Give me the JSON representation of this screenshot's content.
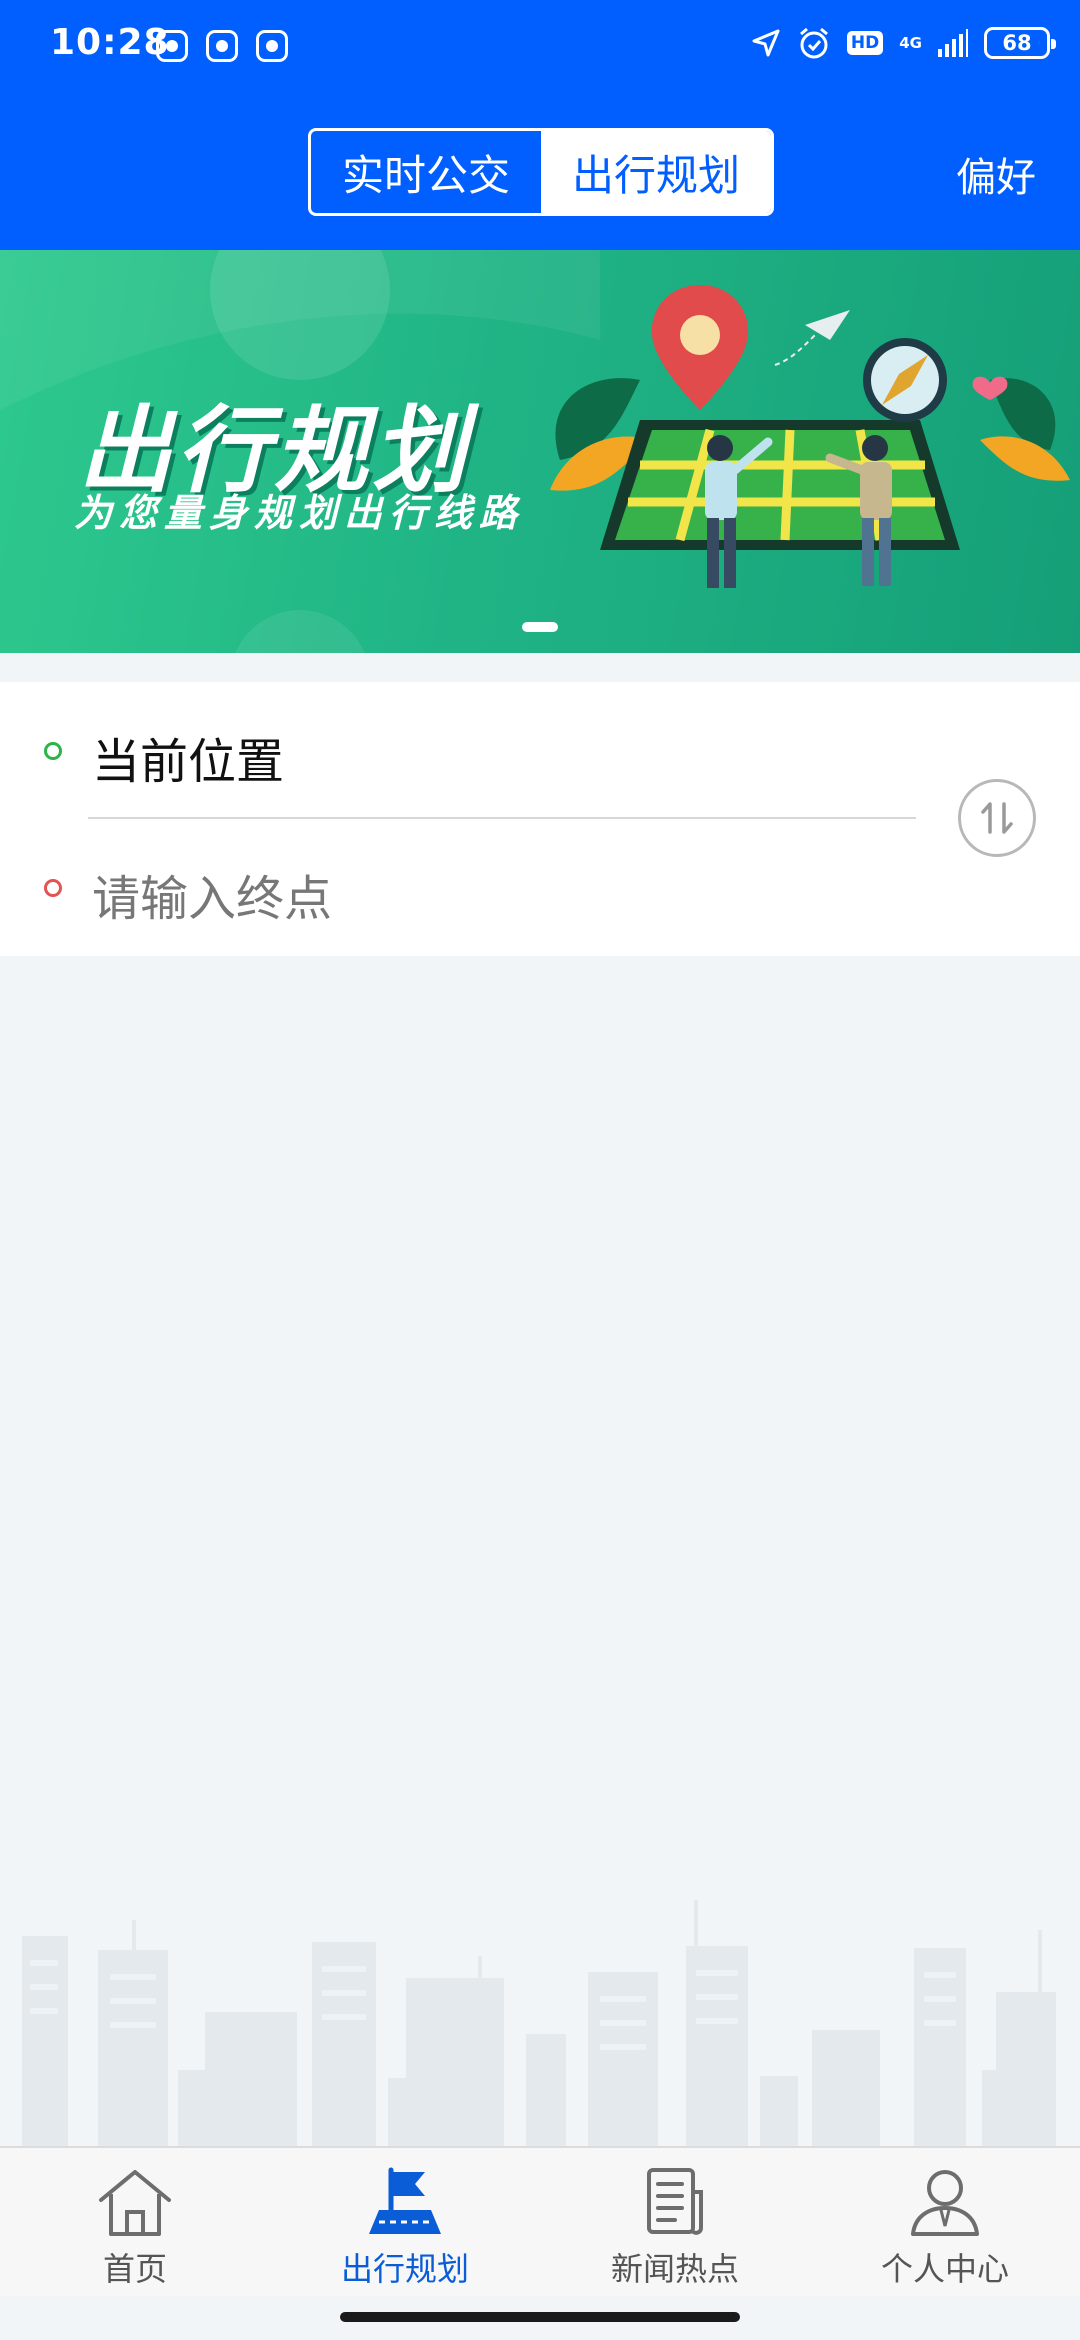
{
  "status_bar": {
    "time": "10:28",
    "notifications": [
      "app-notification-icon",
      "bus-notification-icon",
      "photo-notification-icon"
    ],
    "hd_label": "HD",
    "network_label": "4G",
    "battery_level": "68"
  },
  "header": {
    "tabs": [
      {
        "label": "实时公交",
        "active": false
      },
      {
        "label": "出行规划",
        "active": true
      }
    ],
    "preference_label": "偏好",
    "background_color": "#005ffe"
  },
  "banner": {
    "title": "出行规划",
    "subtitle": "为您量身规划出行线路",
    "current_slide": 1,
    "slide_count": 1
  },
  "route": {
    "start_value": "当前位置",
    "end_placeholder": "请输入终点",
    "start_color": "#2cb34a",
    "end_color": "#e25454"
  },
  "tabbar": {
    "items": [
      {
        "label": "首页",
        "icon": "home-icon",
        "active": false
      },
      {
        "label": "出行规划",
        "icon": "flag-icon",
        "active": true
      },
      {
        "label": "新闻热点",
        "icon": "news-icon",
        "active": false
      },
      {
        "label": "个人中心",
        "icon": "user-icon",
        "active": false
      }
    ],
    "active_color": "#0a5dd7"
  }
}
